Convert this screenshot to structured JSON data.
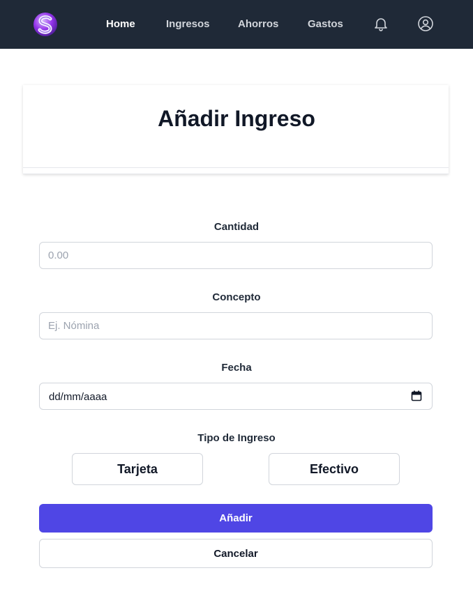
{
  "nav": {
    "logo_letter": "S",
    "links": [
      {
        "label": "Home",
        "active": true
      },
      {
        "label": "Ingresos",
        "active": false
      },
      {
        "label": "Ahorros",
        "active": false
      },
      {
        "label": "Gastos",
        "active": false
      }
    ],
    "icons": [
      "bell-icon",
      "user-circle-icon"
    ]
  },
  "page": {
    "title": "Añadir Ingreso"
  },
  "form": {
    "cantidad": {
      "label": "Cantidad",
      "placeholder": "0.00"
    },
    "concepto": {
      "label": "Concepto",
      "placeholder": "Ej. Nómina"
    },
    "fecha": {
      "label": "Fecha",
      "value_text": "dd/mm/aaaa",
      "icon": "calendar-icon"
    },
    "tipo": {
      "label": "Tipo de Ingreso",
      "options": [
        "Tarjeta",
        "Efectivo"
      ]
    },
    "submit_label": "Añadir",
    "cancel_label": "Cancelar"
  },
  "colors": {
    "navbar": "#1f2937",
    "primary": "#4f46e5",
    "border": "#d1d5db",
    "placeholder": "#9ca3af"
  }
}
